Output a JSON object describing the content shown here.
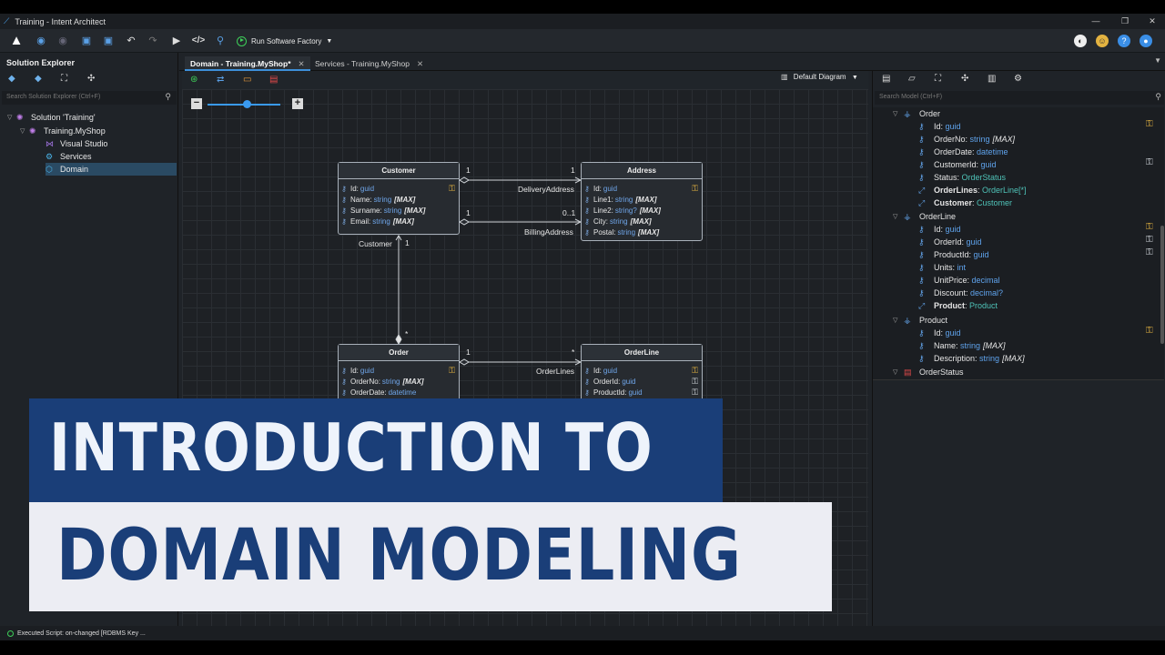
{
  "window": {
    "title": "Training - Intent Architect",
    "min": "—",
    "max": "❐",
    "close": "✕"
  },
  "toolbar": {
    "run_label": "Run Software Factory"
  },
  "solution_explorer": {
    "title": "Solution Explorer",
    "search_placeholder": "Search Solution Explorer (Ctrl+F)",
    "tree": [
      {
        "label": "Solution 'Training'"
      },
      {
        "label": "Training.MyShop"
      },
      {
        "label": "Visual Studio"
      },
      {
        "label": "Services"
      },
      {
        "label": "Domain"
      }
    ]
  },
  "tabs": [
    {
      "label": "Domain - Training.MyShop*"
    },
    {
      "label": "Services - Training.MyShop"
    }
  ],
  "diagram": {
    "selector": "Default Diagram",
    "classes": {
      "customer": {
        "name": "Customer",
        "attrs": [
          {
            "n": "Id",
            "t": "guid",
            "m": ""
          },
          {
            "n": "Name",
            "t": "string",
            "m": "[MAX]"
          },
          {
            "n": "Surname",
            "t": "string",
            "m": "[MAX]"
          },
          {
            "n": "Email",
            "t": "string",
            "m": "[MAX]"
          }
        ]
      },
      "address": {
        "name": "Address",
        "attrs": [
          {
            "n": "Id",
            "t": "guid",
            "m": ""
          },
          {
            "n": "Line1",
            "t": "string",
            "m": "[MAX]"
          },
          {
            "n": "Line2",
            "t": "string?",
            "m": "[MAX]"
          },
          {
            "n": "City",
            "t": "string",
            "m": "[MAX]"
          },
          {
            "n": "Postal",
            "t": "string",
            "m": "[MAX]"
          }
        ]
      },
      "order": {
        "name": "Order",
        "attrs": [
          {
            "n": "Id",
            "t": "guid",
            "m": ""
          },
          {
            "n": "OrderNo",
            "t": "string",
            "m": "[MAX]"
          },
          {
            "n": "OrderDate",
            "t": "datetime",
            "m": ""
          }
        ]
      },
      "orderline": {
        "name": "OrderLine",
        "attrs": [
          {
            "n": "Id",
            "t": "guid",
            "m": ""
          },
          {
            "n": "OrderId",
            "t": "guid",
            "m": ""
          },
          {
            "n": "ProductId",
            "t": "guid",
            "m": ""
          }
        ]
      }
    },
    "labels": {
      "delivery": "DeliveryAddress",
      "billing": "BillingAddress",
      "customer_role": "Customer",
      "orderlines": "OrderLines",
      "m1": "1",
      "m2": "1",
      "m3": "1",
      "m4": "0..1",
      "m5": "1",
      "m6": "*",
      "m7": "1",
      "m8": "*"
    }
  },
  "model_tree": {
    "search_placeholder": "Search Model (Ctrl+F)",
    "rows": [
      {
        "name": "Order",
        "type": "",
        "mod": ""
      },
      {
        "name": "Id",
        "type": "guid",
        "mod": ""
      },
      {
        "name": "OrderNo",
        "type": "string",
        "mod": "[MAX]"
      },
      {
        "name": "OrderDate",
        "type": "datetime",
        "mod": ""
      },
      {
        "name": "CustomerId",
        "type": "guid",
        "mod": ""
      },
      {
        "name": "Status",
        "type": "OrderStatus",
        "mod": ""
      },
      {
        "name": "OrderLines",
        "type": "OrderLine[*]",
        "mod": ""
      },
      {
        "name": "Customer",
        "type": "Customer",
        "mod": ""
      },
      {
        "name": "OrderLine",
        "type": "",
        "mod": ""
      },
      {
        "name": "Id",
        "type": "guid",
        "mod": ""
      },
      {
        "name": "OrderId",
        "type": "guid",
        "mod": ""
      },
      {
        "name": "ProductId",
        "type": "guid",
        "mod": ""
      },
      {
        "name": "Units",
        "type": "int",
        "mod": ""
      },
      {
        "name": "UnitPrice",
        "type": "decimal",
        "mod": ""
      },
      {
        "name": "Discount",
        "type": "decimal?",
        "mod": ""
      },
      {
        "name": "Product",
        "type": "Product",
        "mod": ""
      },
      {
        "name": "Product",
        "type": "",
        "mod": ""
      },
      {
        "name": "Id",
        "type": "guid",
        "mod": ""
      },
      {
        "name": "Name",
        "type": "string",
        "mod": "[MAX]"
      },
      {
        "name": "Description",
        "type": "string",
        "mod": "[MAX]"
      },
      {
        "name": "OrderStatus",
        "type": "",
        "mod": ""
      }
    ]
  },
  "status": {
    "text": "Executed Script: on-changed [RDBMS Key ..."
  },
  "banner": {
    "line1": "INTRODUCTION TO",
    "line2": "DOMAIN MODELING"
  },
  "colors": {
    "accent": "#1a3e78",
    "banner_light": "#ecedf3",
    "type_blue": "#5fa3ec",
    "key_gold": "#e3b341"
  }
}
